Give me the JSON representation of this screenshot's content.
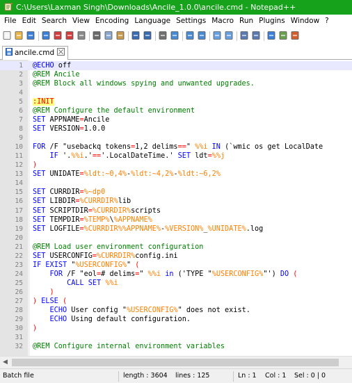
{
  "window": {
    "title": "C:\\Users\\Laxman Singh\\Downloads\\Ancile_1.0.0\\ancile.cmd - Notepad++",
    "title_bar_color": "#16a31b",
    "app_icon": "notepad-plus-plus-icon"
  },
  "menu": [
    "File",
    "Edit",
    "Search",
    "View",
    "Encoding",
    "Language",
    "Settings",
    "Macro",
    "Run",
    "Plugins",
    "Window",
    "?"
  ],
  "toolbar": {
    "buttons": [
      {
        "name": "new-file-icon"
      },
      {
        "name": "open-file-icon"
      },
      {
        "name": "save-icon"
      },
      {
        "name": "save-all-icon"
      },
      {
        "name": "close-icon"
      },
      {
        "name": "close-all-icon"
      },
      {
        "name": "print-icon"
      },
      {
        "name": "cut-icon"
      },
      {
        "name": "copy-icon"
      },
      {
        "name": "paste-icon"
      },
      {
        "name": "undo-icon"
      },
      {
        "name": "redo-icon"
      },
      {
        "name": "find-icon"
      },
      {
        "name": "replace-icon"
      },
      {
        "name": "zoom-in-icon"
      },
      {
        "name": "zoom-out-icon"
      },
      {
        "name": "sync-vertical-icon"
      },
      {
        "name": "sync-horizontal-icon"
      },
      {
        "name": "word-wrap-icon"
      },
      {
        "name": "show-all-characters-icon"
      },
      {
        "name": "indent-guide-icon"
      },
      {
        "name": "user-language-icon"
      },
      {
        "name": "document-map-icon"
      }
    ]
  },
  "tab": {
    "label": "ancile.cmd",
    "icon": "saved-file-icon"
  },
  "editor": {
    "current_line": 1,
    "lines": [
      {
        "n": "1",
        "tokens": [
          {
            "t": "@ECHO",
            "s": "kw"
          },
          {
            "t": " off",
            "s": "plain"
          }
        ]
      },
      {
        "n": "2",
        "tokens": [
          {
            "t": "@REM Ancile",
            "s": "cmt"
          }
        ]
      },
      {
        "n": "3",
        "tokens": [
          {
            "t": "@REM Block all windows spying and unwanted upgrades.",
            "s": "cmt"
          }
        ]
      },
      {
        "n": "4",
        "tokens": []
      },
      {
        "n": "5",
        "tokens": [
          {
            "t": ":INIT",
            "s": "lbl"
          }
        ]
      },
      {
        "n": "6",
        "tokens": [
          {
            "t": "@REM Configure the default environment",
            "s": "cmt"
          }
        ]
      },
      {
        "n": "7",
        "tokens": [
          {
            "t": "SET",
            "s": "kw"
          },
          {
            "t": " APPNAME",
            "s": "plain"
          },
          {
            "t": "=",
            "s": "op"
          },
          {
            "t": "Ancile",
            "s": "plain"
          }
        ]
      },
      {
        "n": "8",
        "tokens": [
          {
            "t": "SET",
            "s": "kw"
          },
          {
            "t": " VERSION",
            "s": "plain"
          },
          {
            "t": "=",
            "s": "op"
          },
          {
            "t": "1.0.0",
            "s": "plain"
          }
        ]
      },
      {
        "n": "9",
        "tokens": []
      },
      {
        "n": "10",
        "tokens": [
          {
            "t": "FOR",
            "s": "kw"
          },
          {
            "t": " /F \"usebackq tokens",
            "s": "plain"
          },
          {
            "t": "=",
            "s": "op"
          },
          {
            "t": "1,2 delims",
            "s": "plain"
          },
          {
            "t": "==",
            "s": "op"
          },
          {
            "t": "\" ",
            "s": "plain"
          },
          {
            "t": "%%i",
            "s": "var"
          },
          {
            "t": " ",
            "s": "plain"
          },
          {
            "t": "IN",
            "s": "kw"
          },
          {
            "t": " (`wmic os get LocalDate",
            "s": "plain"
          }
        ]
      },
      {
        "n": "11",
        "tokens": [
          {
            "t": "    ",
            "s": "plain"
          },
          {
            "t": "IF",
            "s": "kw"
          },
          {
            "t": " '.",
            "s": "plain"
          },
          {
            "t": "%%i",
            "s": "var"
          },
          {
            "t": ".'",
            "s": "plain"
          },
          {
            "t": "==",
            "s": "op"
          },
          {
            "t": "'.LocalDateTime.' ",
            "s": "plain"
          },
          {
            "t": "SET",
            "s": "kw"
          },
          {
            "t": " ldt",
            "s": "plain"
          },
          {
            "t": "=",
            "s": "op"
          },
          {
            "t": "%%j",
            "s": "var"
          }
        ]
      },
      {
        "n": "12",
        "tokens": [
          {
            "t": ")",
            "s": "op"
          }
        ]
      },
      {
        "n": "13",
        "tokens": [
          {
            "t": "SET",
            "s": "kw"
          },
          {
            "t": " UNIDATE",
            "s": "plain"
          },
          {
            "t": "=",
            "s": "op"
          },
          {
            "t": "%ldt:~0,4%",
            "s": "var"
          },
          {
            "t": "-",
            "s": "plain"
          },
          {
            "t": "%ldt:~4,2%",
            "s": "var"
          },
          {
            "t": "-",
            "s": "plain"
          },
          {
            "t": "%ldt:~6,2%",
            "s": "var"
          }
        ]
      },
      {
        "n": "14",
        "tokens": []
      },
      {
        "n": "15",
        "tokens": [
          {
            "t": "SET",
            "s": "kw"
          },
          {
            "t": " CURRDIR",
            "s": "plain"
          },
          {
            "t": "=",
            "s": "op"
          },
          {
            "t": "%~dp0",
            "s": "var"
          }
        ]
      },
      {
        "n": "16",
        "tokens": [
          {
            "t": "SET",
            "s": "kw"
          },
          {
            "t": " LIBDIR",
            "s": "plain"
          },
          {
            "t": "=",
            "s": "op"
          },
          {
            "t": "%CURRDIR%",
            "s": "var"
          },
          {
            "t": "lib",
            "s": "plain"
          }
        ]
      },
      {
        "n": "17",
        "tokens": [
          {
            "t": "SET",
            "s": "kw"
          },
          {
            "t": " SCRIPTDIR",
            "s": "plain"
          },
          {
            "t": "=",
            "s": "op"
          },
          {
            "t": "%CURRDIR%",
            "s": "var"
          },
          {
            "t": "scripts",
            "s": "plain"
          }
        ]
      },
      {
        "n": "18",
        "tokens": [
          {
            "t": "SET",
            "s": "kw"
          },
          {
            "t": " TEMPDIR",
            "s": "plain"
          },
          {
            "t": "=",
            "s": "op"
          },
          {
            "t": "%TEMP%",
            "s": "var"
          },
          {
            "t": "\\",
            "s": "plain"
          },
          {
            "t": "%APPNAME%",
            "s": "var"
          }
        ]
      },
      {
        "n": "19",
        "tokens": [
          {
            "t": "SET",
            "s": "kw"
          },
          {
            "t": " LOGFILE",
            "s": "plain"
          },
          {
            "t": "=",
            "s": "op"
          },
          {
            "t": "%CURRDIR%%APPNAME%",
            "s": "var"
          },
          {
            "t": "-",
            "s": "plain"
          },
          {
            "t": "%VERSION%",
            "s": "var"
          },
          {
            "t": "_",
            "s": "plain"
          },
          {
            "t": "%UNIDATE%",
            "s": "var"
          },
          {
            "t": ".log",
            "s": "plain"
          }
        ]
      },
      {
        "n": "20",
        "tokens": []
      },
      {
        "n": "21",
        "tokens": [
          {
            "t": "@REM Load user environment configuration",
            "s": "cmt"
          }
        ]
      },
      {
        "n": "22",
        "tokens": [
          {
            "t": "SET",
            "s": "kw"
          },
          {
            "t": " USERCONFIG",
            "s": "plain"
          },
          {
            "t": "=",
            "s": "op"
          },
          {
            "t": "%CURRDIR%",
            "s": "var"
          },
          {
            "t": "config.ini",
            "s": "plain"
          }
        ]
      },
      {
        "n": "23",
        "tokens": [
          {
            "t": "IF",
            "s": "kw"
          },
          {
            "t": " ",
            "s": "plain"
          },
          {
            "t": "EXIST",
            "s": "kw"
          },
          {
            "t": " \"",
            "s": "plain"
          },
          {
            "t": "%USERCONFIG%",
            "s": "var"
          },
          {
            "t": "\" ",
            "s": "plain"
          },
          {
            "t": "(",
            "s": "op"
          }
        ]
      },
      {
        "n": "24",
        "tokens": [
          {
            "t": "    ",
            "s": "plain"
          },
          {
            "t": "FOR",
            "s": "kw"
          },
          {
            "t": " /F \"eol",
            "s": "plain"
          },
          {
            "t": "=",
            "s": "op"
          },
          {
            "t": "# delims",
            "s": "plain"
          },
          {
            "t": "=",
            "s": "op"
          },
          {
            "t": "\" ",
            "s": "plain"
          },
          {
            "t": "%%i",
            "s": "var"
          },
          {
            "t": " ",
            "s": "plain"
          },
          {
            "t": "in",
            "s": "kw"
          },
          {
            "t": " ('TYPE \"",
            "s": "plain"
          },
          {
            "t": "%USERCONFIG%",
            "s": "var"
          },
          {
            "t": "\"') ",
            "s": "plain"
          },
          {
            "t": "DO",
            "s": "kw"
          },
          {
            "t": " ",
            "s": "plain"
          },
          {
            "t": "(",
            "s": "op"
          }
        ]
      },
      {
        "n": "25",
        "tokens": [
          {
            "t": "        ",
            "s": "plain"
          },
          {
            "t": "CALL",
            "s": "kw"
          },
          {
            "t": " ",
            "s": "plain"
          },
          {
            "t": "SET",
            "s": "kw"
          },
          {
            "t": " ",
            "s": "plain"
          },
          {
            "t": "%%i",
            "s": "var"
          }
        ]
      },
      {
        "n": "26",
        "tokens": [
          {
            "t": "    ",
            "s": "plain"
          },
          {
            "t": ")",
            "s": "op"
          }
        ]
      },
      {
        "n": "27",
        "tokens": [
          {
            "t": ")",
            "s": "op"
          },
          {
            "t": " ",
            "s": "plain"
          },
          {
            "t": "ELSE",
            "s": "kw"
          },
          {
            "t": " ",
            "s": "plain"
          },
          {
            "t": "(",
            "s": "op"
          }
        ]
      },
      {
        "n": "28",
        "tokens": [
          {
            "t": "    ",
            "s": "plain"
          },
          {
            "t": "ECHO",
            "s": "kw"
          },
          {
            "t": " User config \"",
            "s": "plain"
          },
          {
            "t": "%USERCONFIG%",
            "s": "var"
          },
          {
            "t": "\" does not exist.",
            "s": "plain"
          }
        ]
      },
      {
        "n": "29",
        "tokens": [
          {
            "t": "    ",
            "s": "plain"
          },
          {
            "t": "ECHO",
            "s": "kw"
          },
          {
            "t": " Using default configuration.",
            "s": "plain"
          }
        ]
      },
      {
        "n": "30",
        "tokens": [
          {
            "t": ")",
            "s": "op"
          }
        ]
      },
      {
        "n": "31",
        "tokens": []
      },
      {
        "n": "32",
        "tokens": [
          {
            "t": "@REM Configure internal environment variables",
            "s": "cmt"
          }
        ]
      }
    ]
  },
  "status": {
    "file_type": "Batch file",
    "length": "length : 3604",
    "lines": "lines : 125",
    "ln": "Ln : 1",
    "col": "Col : 1",
    "sel": "Sel : 0 | 0"
  }
}
